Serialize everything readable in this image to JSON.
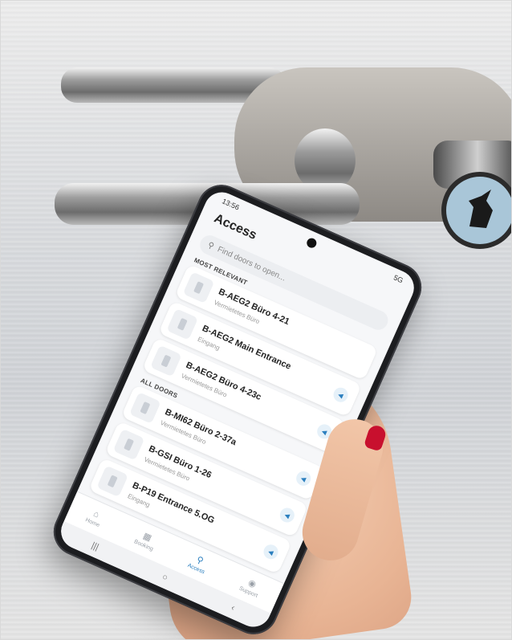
{
  "phone_screen": {
    "status_time": "13:56",
    "status_right": "5G",
    "title": "Access",
    "search_placeholder": "Find doors to open...",
    "section_relevant": "MOST RELEVANT",
    "section_all": "ALL DOORS",
    "relevant_doors": [
      {
        "name": "B-AEG2 Büro 4-21",
        "sub": "Vermietetes Büro"
      },
      {
        "name": "B-AEG2 Main Entrance",
        "sub": "Eingang"
      },
      {
        "name": "B-AEG2 Büro 4-23c",
        "sub": "Vermietetes Büro"
      }
    ],
    "all_doors": [
      {
        "name": "B-MI62 Büro 2-37a",
        "sub": "Vermietetes Büro"
      },
      {
        "name": "B-GSI Büro 1-26",
        "sub": "Vermietetes Büro"
      },
      {
        "name": "B-P19 Entrance 5.OG",
        "sub": "Eingang"
      }
    ],
    "tabs": [
      {
        "label": "Home",
        "icon": "home-icon"
      },
      {
        "label": "Booking",
        "icon": "calendar-icon"
      },
      {
        "label": "Access",
        "icon": "key-icon"
      },
      {
        "label": "Support",
        "icon": "support-icon"
      }
    ],
    "accent": "#2b7fbf"
  },
  "scene": {
    "nail_color": "#c8102e",
    "lock_logo": "unicorn-icon"
  }
}
